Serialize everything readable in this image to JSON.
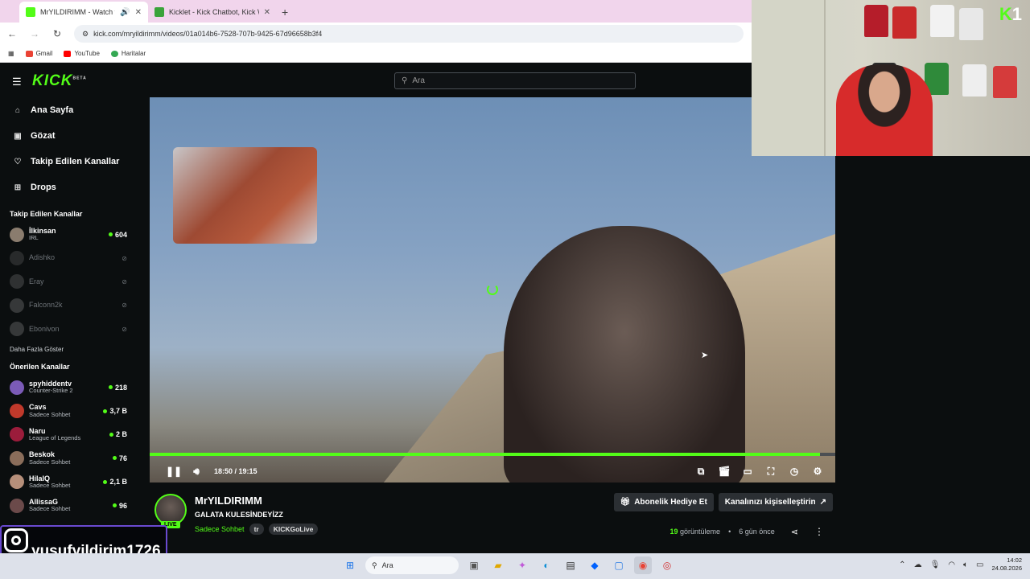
{
  "browser": {
    "tabs": [
      {
        "title": "MrYILDIRIMM - Watch the",
        "active": true,
        "favicon_color": "#53fc18"
      },
      {
        "title": "Kicklet - Kick Chatbot, Kick Wid",
        "active": false,
        "favicon_color": "#3aa33a"
      }
    ],
    "url": "kick.com/mryildirimm/videos/01a014b6-7528-707b-9425-67d96658b3f4",
    "bookmarks": [
      "Gmail",
      "YouTube",
      "Haritalar"
    ]
  },
  "header": {
    "logo": "KICK",
    "logo_sup": "BETA",
    "search_placeholder": "Ara"
  },
  "sidebar": {
    "nav": [
      {
        "label": "Ana Sayfa",
        "icon": "home-icon"
      },
      {
        "label": "Gözat",
        "icon": "browse-icon"
      },
      {
        "label": "Takip Edilen Kanallar",
        "icon": "heart-icon"
      },
      {
        "label": "Drops",
        "icon": "gift-icon"
      }
    ],
    "followed_heading": "Takip Edilen Kanallar",
    "followed": [
      {
        "name": "İlkinsan",
        "category": "IRL",
        "count": "604",
        "live": true,
        "avatar_color": "#8a7c6e"
      },
      {
        "name": "Adishko",
        "category": "",
        "count": "",
        "live": false,
        "avatar_color": "#555"
      },
      {
        "name": "Eray",
        "category": "",
        "count": "",
        "live": false,
        "avatar_color": "#666"
      },
      {
        "name": "Falconn2k",
        "category": "",
        "count": "",
        "live": false,
        "avatar_color": "#777"
      },
      {
        "name": "Ebonivon",
        "category": "",
        "count": "",
        "live": false,
        "avatar_color": "#777"
      }
    ],
    "show_more": "Daha Fazla Göster",
    "recommended_heading": "Önerilen Kanallar",
    "recommended": [
      {
        "name": "spyhiddentv",
        "category": "Counter-Strike 2",
        "count": "218",
        "avatar_color": "#7b5bb7"
      },
      {
        "name": "Cavs",
        "category": "Sadece Sohbet",
        "count": "3,7 B",
        "avatar_color": "#c0392b"
      },
      {
        "name": "Naru",
        "category": "League of Legends",
        "count": "2 B",
        "avatar_color": "#9b1c3b"
      },
      {
        "name": "Beskok",
        "category": "Sadece Sohbet",
        "count": "76",
        "avatar_color": "#8a6d5a"
      },
      {
        "name": "HilalQ",
        "category": "Sadece Sohbet",
        "count": "2,1 B",
        "avatar_color": "#b68f7a"
      },
      {
        "name": "AllissaG",
        "category": "Sadece Sohbet",
        "count": "96",
        "avatar_color": "#6b4a4a"
      }
    ]
  },
  "player": {
    "time": "18:50 / 19:15",
    "progress_fraction": 0.978
  },
  "channel": {
    "name": "MrYILDIRIMM",
    "live_badge": "LIVE",
    "title": "GALATA KULESİNDEYİZZ",
    "category": "Sadece Sohbet",
    "language": "tr",
    "tag": "KICKGoLive",
    "gift_button": "Abonelik Hediye Et",
    "customize_button": "Kanalınızı kişiselleştirin",
    "views_count": "19",
    "views_label": "görüntüleme",
    "age": "6 gün önce"
  },
  "overlay": {
    "instagram_handle": "yusufyildirim1726",
    "webcam_brand_letter": "K",
    "webcam_brand_number": "1"
  },
  "taskbar": {
    "search_placeholder": "Ara",
    "time": "14:02",
    "date": "24.08.2026"
  },
  "colors": {
    "accent": "#53fc18",
    "background": "#0b0e0f"
  }
}
